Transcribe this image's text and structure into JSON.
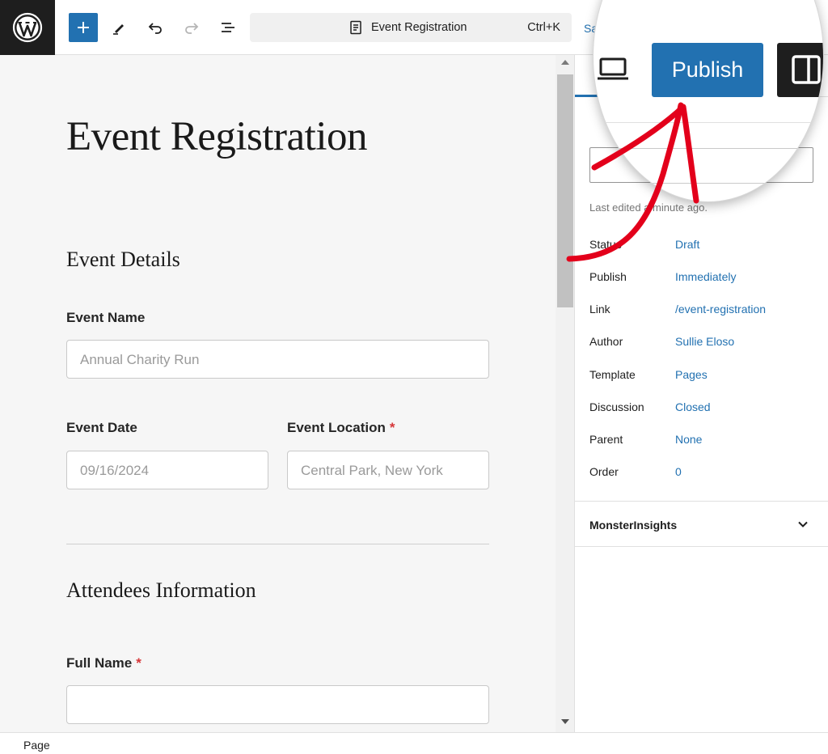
{
  "toolbar": {
    "document_title": "Event Registration",
    "shortcut": "Ctrl+K",
    "save_label": "Save",
    "publish_label": "Publish",
    "accent_color": "#2271b1",
    "icons": [
      "wordpress-logo-icon",
      "plus-icon",
      "pencil-icon",
      "undo-icon",
      "redo-icon",
      "list-view-icon",
      "document-icon",
      "laptop-icon",
      "sidebar-panel-icon"
    ]
  },
  "canvas": {
    "page_title": "Event Registration",
    "sections": {
      "event_details": "Event Details",
      "attendees": "Attendees Information"
    },
    "fields": {
      "event_name": {
        "label": "Event Name",
        "placeholder": "Annual Charity Run"
      },
      "event_date": {
        "label": "Event Date",
        "placeholder": "09/16/2024"
      },
      "event_location": {
        "label": "Event Location",
        "required": "*",
        "placeholder": "Central Park, New York"
      },
      "full_name": {
        "label": "Full Name",
        "required": "*",
        "placeholder": ""
      }
    }
  },
  "sidebar": {
    "last_edited": "Last edited a minute ago.",
    "meta": [
      {
        "label": "Status",
        "value": "Draft"
      },
      {
        "label": "Publish",
        "value": "Immediately"
      },
      {
        "label": "Link",
        "value": "/event-registration"
      },
      {
        "label": "Author",
        "value": "Sullie Eloso"
      },
      {
        "label": "Template",
        "value": "Pages"
      },
      {
        "label": "Discussion",
        "value": "Closed"
      },
      {
        "label": "Parent",
        "value": "None"
      },
      {
        "label": "Order",
        "value": "0"
      }
    ],
    "panel": "MonsterInsights"
  },
  "statusbar": {
    "breadcrumb": "Page"
  },
  "annotation": {
    "arrow_color": "#e3001b"
  }
}
